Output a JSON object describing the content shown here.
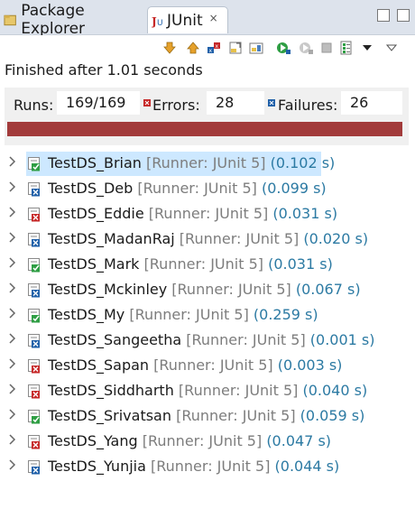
{
  "tabs": [
    {
      "label": "Package Explorer"
    },
    {
      "label": "JUnit",
      "close": "×"
    }
  ],
  "status": "Finished after 1.01 seconds",
  "counters": {
    "runs_label": "Runs:",
    "runs_value": "169/169",
    "errors_label": "Errors:",
    "errors_value": "28",
    "failures_label": "Failures:",
    "failures_value": "26"
  },
  "progress": {
    "fraction": 1.0,
    "color": "#a23b3b"
  },
  "tests": [
    {
      "name": "TestDS_Brian",
      "runner": "[Runner: JUnit 5]",
      "time": "(0.102 s)",
      "status": "pass",
      "selected": true
    },
    {
      "name": "TestDS_Deb",
      "runner": "[Runner: JUnit 5]",
      "time": "(0.099 s)",
      "status": "fail"
    },
    {
      "name": "TestDS_Eddie",
      "runner": "[Runner: JUnit 5]",
      "time": "(0.031 s)",
      "status": "error"
    },
    {
      "name": "TestDS_MadanRaj",
      "runner": "[Runner: JUnit 5]",
      "time": "(0.020 s)",
      "status": "fail"
    },
    {
      "name": "TestDS_Mark",
      "runner": "[Runner: JUnit 5]",
      "time": "(0.031 s)",
      "status": "pass"
    },
    {
      "name": "TestDS_Mckinley",
      "runner": "[Runner: JUnit 5]",
      "time": "(0.067 s)",
      "status": "fail"
    },
    {
      "name": "TestDS_My",
      "runner": "[Runner: JUnit 5]",
      "time": "(0.259 s)",
      "status": "pass"
    },
    {
      "name": "TestDS_Sangeetha",
      "runner": "[Runner: JUnit 5]",
      "time": "(0.001 s)",
      "status": "fail"
    },
    {
      "name": "TestDS_Sapan",
      "runner": "[Runner: JUnit 5]",
      "time": "(0.003 s)",
      "status": "error"
    },
    {
      "name": "TestDS_Siddharth",
      "runner": "[Runner: JUnit 5]",
      "time": "(0.040 s)",
      "status": "error"
    },
    {
      "name": "TestDS_Srivatsan",
      "runner": "[Runner: JUnit 5]",
      "time": "(0.059 s)",
      "status": "pass"
    },
    {
      "name": "TestDS_Yang",
      "runner": "[Runner: JUnit 5]",
      "time": "(0.047 s)",
      "status": "error"
    },
    {
      "name": "TestDS_Yunjia",
      "runner": "[Runner: JUnit 5]",
      "time": "(0.044 s)",
      "status": "fail"
    }
  ],
  "toolbar_icons": [
    "next-failure-icon",
    "previous-failure-icon",
    "show-failures-only-icon",
    "scroll-lock-icon",
    "show-skipped-icon",
    "rerun-icon",
    "rerun-failed-first-icon",
    "stop-icon",
    "test-run-history-icon",
    "view-menu-icon",
    "minimize-icon"
  ],
  "colors": {
    "pass": "#2f9e44",
    "error": "#c62828",
    "fail": "#1f5fa8",
    "selected": "#cde8ff"
  }
}
